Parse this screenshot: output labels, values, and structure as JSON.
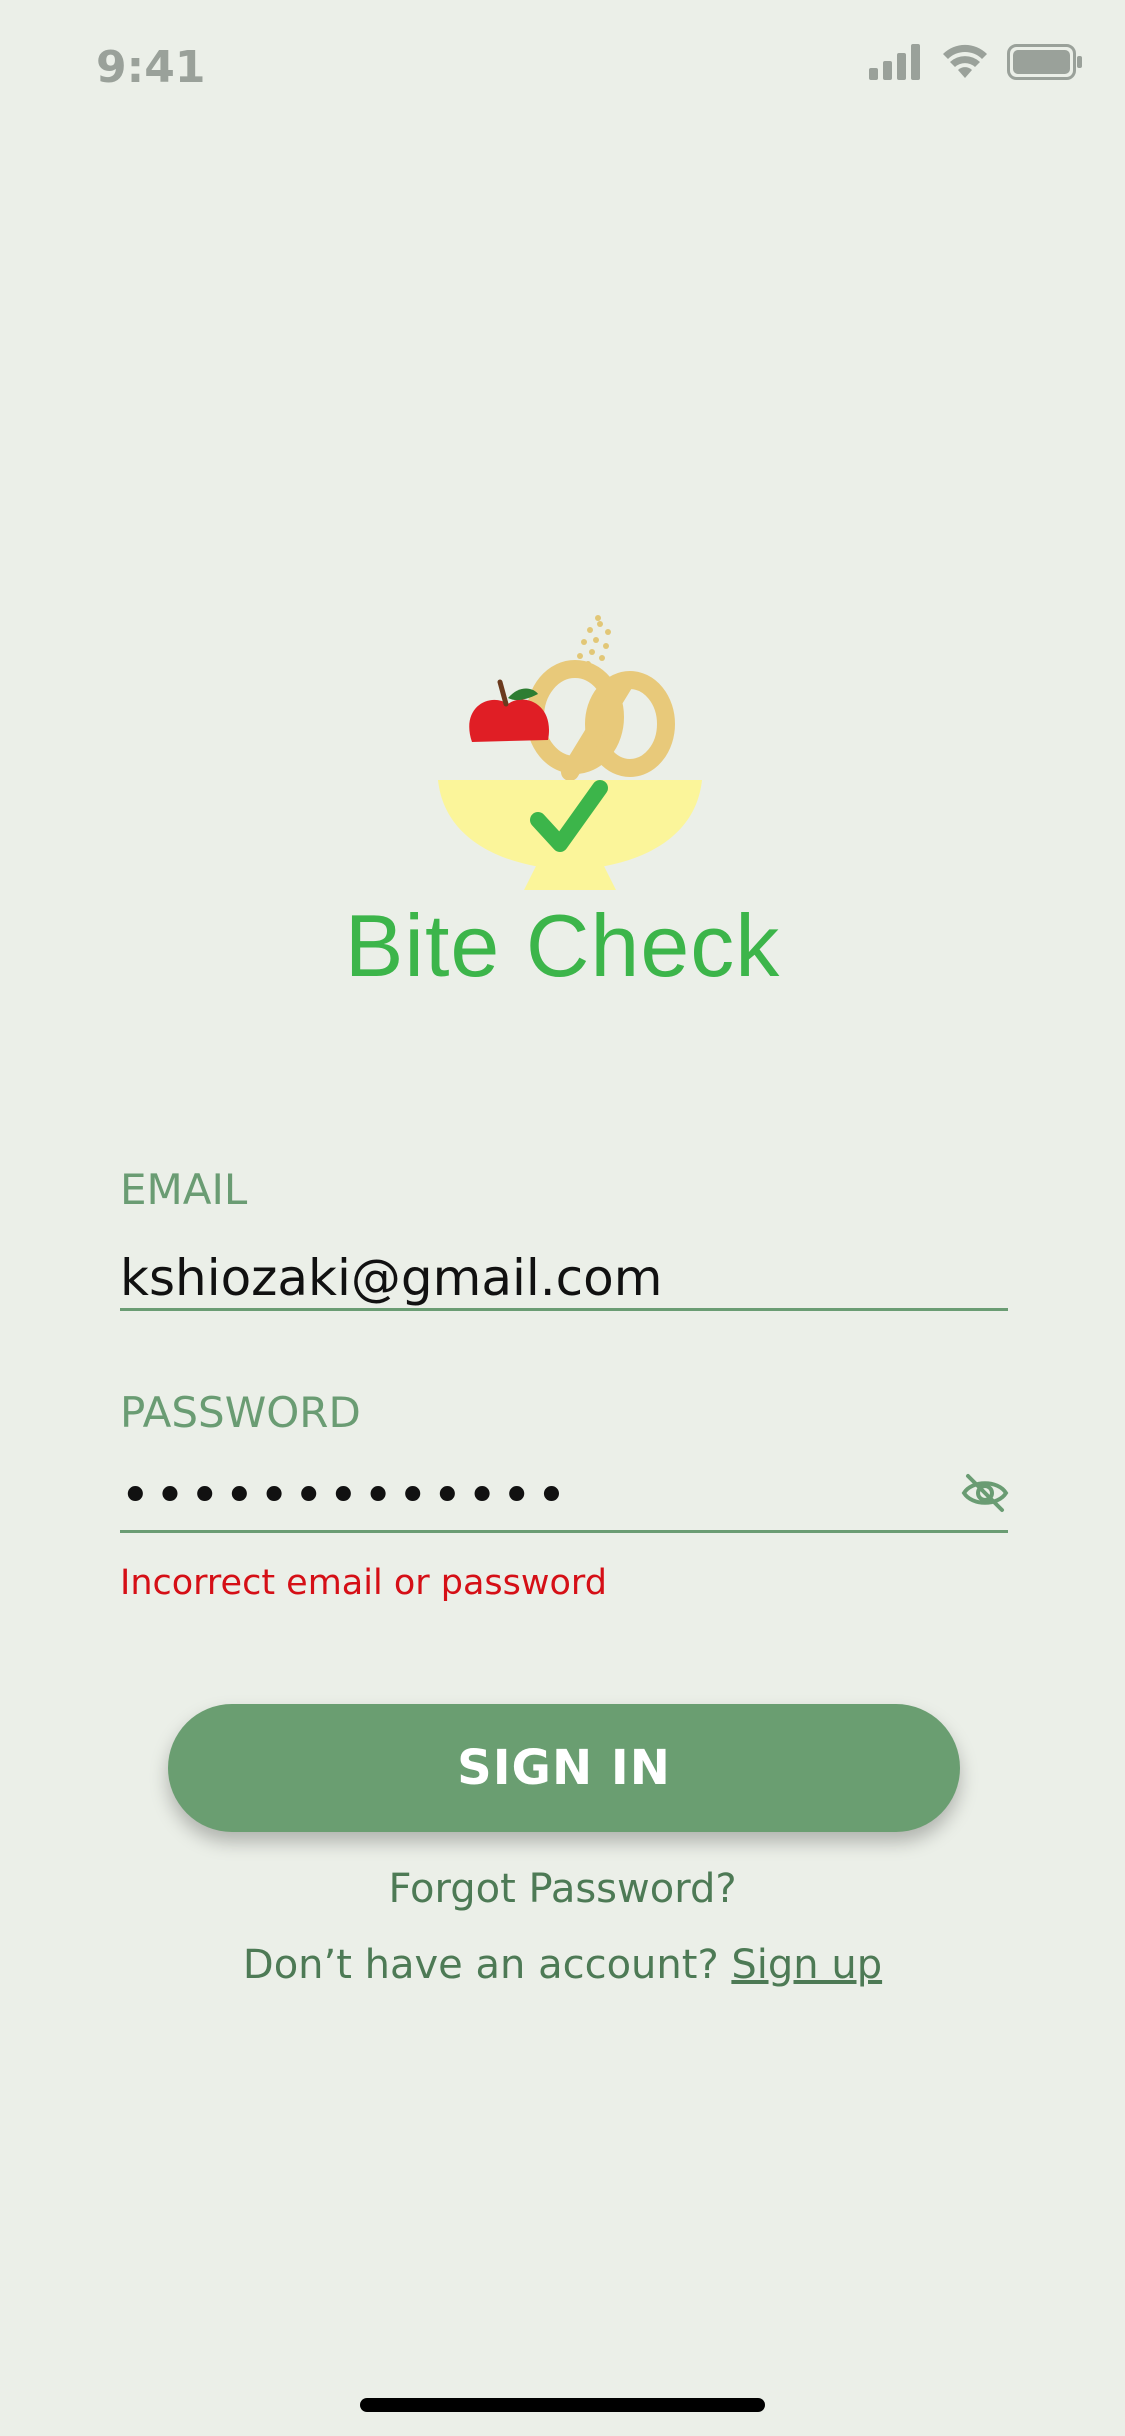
{
  "status_bar": {
    "time": "9:41",
    "icons": [
      "cellular-signal-icon",
      "wifi-icon",
      "battery-icon"
    ]
  },
  "brand": {
    "name": "Bite Check",
    "logo_icon": "bowl-with-apple-pretzel-check-icon"
  },
  "form": {
    "email": {
      "label": "EMAIL",
      "value": "kshiozaki@gmail.com"
    },
    "password": {
      "label": "PASSWORD",
      "masked_value": "•••••••••••••",
      "visibility_icon": "eye-off-icon"
    },
    "error": "Incorrect email or password"
  },
  "actions": {
    "sign_in": "SIGN IN",
    "forgot_password": "Forgot Password?",
    "no_account_prompt": "Don’t have an account?",
    "sign_up": "Sign up"
  },
  "colors": {
    "background": "#ebefe8",
    "accent": "#6a9e71",
    "brand_green": "#3cb54a",
    "error": "#d50f16"
  }
}
